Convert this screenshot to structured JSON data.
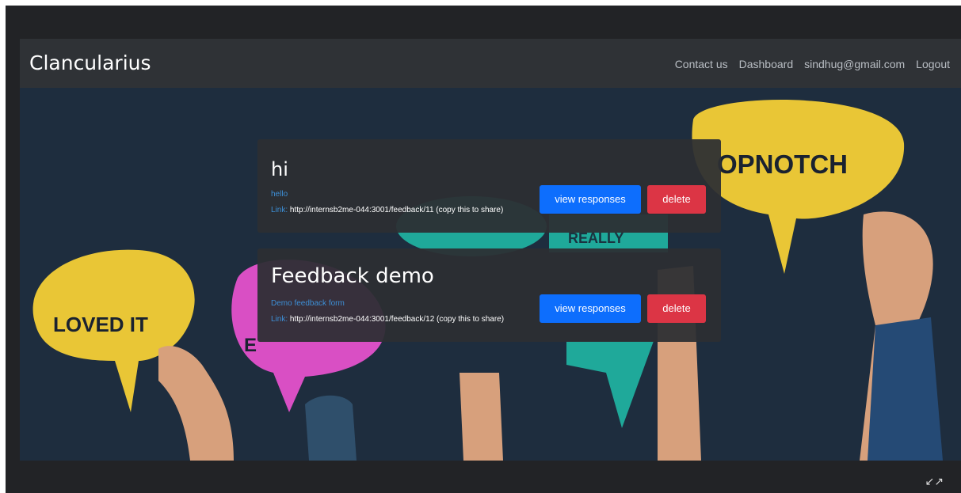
{
  "navbar": {
    "brand": "Clancularius",
    "links": [
      "Contact us",
      "Dashboard",
      "sindhug@gmail.com",
      "Logout"
    ]
  },
  "hero_signs": {
    "topnotch": "OPNOTCH",
    "loved": "LOVED IT",
    "really": "REALLY",
    "e_letter": "E"
  },
  "forms": [
    {
      "title": "hi",
      "description": "hello",
      "link_label": "Link:",
      "link_text": "http://internsb2me-044:3001/feedback/11 (copy this to share)",
      "view_label": "view responses",
      "delete_label": "delete"
    },
    {
      "title": "Feedback demo",
      "description": "Demo feedback form",
      "link_label": "Link:",
      "link_text": "http://internsb2me-044:3001/feedback/12 (copy this to share)",
      "view_label": "view responses",
      "delete_label": "delete"
    }
  ],
  "colors": {
    "primary": "#0d6efd",
    "danger": "#dc3545",
    "link": "#3d8fd6",
    "navbar": "#2f3236"
  },
  "icons": {
    "expand": "collapse-arrows-icon"
  }
}
